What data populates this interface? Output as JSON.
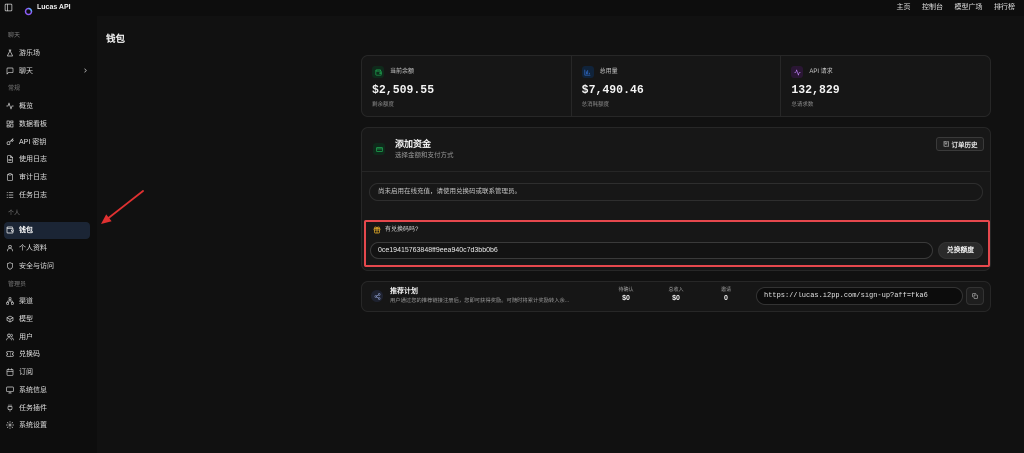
{
  "app": {
    "title": "Lucas API",
    "logo_icon": "logo-ring-icon",
    "toggle_icon": "sidebar-toggle-icon"
  },
  "topnav": {
    "items": [
      {
        "label": "主页"
      },
      {
        "label": "控制台"
      },
      {
        "label": "模型广场"
      },
      {
        "label": "排行榜"
      }
    ]
  },
  "sidebar": {
    "sections": [
      {
        "label": "聊天",
        "items": [
          {
            "label": "游乐场",
            "icon": "flask-icon"
          },
          {
            "label": "聊天",
            "icon": "message-icon",
            "has_submenu": true
          }
        ]
      },
      {
        "label": "常规",
        "items": [
          {
            "label": "概览",
            "icon": "activity-icon"
          },
          {
            "label": "数据看板",
            "icon": "dashboard-icon"
          },
          {
            "label": "API 密钥",
            "icon": "key-icon"
          },
          {
            "label": "使用日志",
            "icon": "file-text-icon"
          },
          {
            "label": "审计日志",
            "icon": "clipboard-icon"
          },
          {
            "label": "任务日志",
            "icon": "list-icon"
          }
        ]
      },
      {
        "label": "个人",
        "items": [
          {
            "label": "钱包",
            "icon": "wallet-icon",
            "active": true
          },
          {
            "label": "个人资料",
            "icon": "user-icon"
          },
          {
            "label": "安全与访问",
            "icon": "shield-icon"
          }
        ]
      },
      {
        "label": "管理员",
        "items": [
          {
            "label": "渠道",
            "icon": "network-icon"
          },
          {
            "label": "模型",
            "icon": "box-icon"
          },
          {
            "label": "用户",
            "icon": "users-icon"
          },
          {
            "label": "兑换码",
            "icon": "ticket-icon"
          },
          {
            "label": "订阅",
            "icon": "calendar-icon"
          },
          {
            "label": "系统信息",
            "icon": "monitor-icon"
          },
          {
            "label": "任务插件",
            "icon": "plug-icon"
          },
          {
            "label": "系统设置",
            "icon": "gear-icon"
          }
        ]
      }
    ]
  },
  "page": {
    "title": "钱包"
  },
  "stats": [
    {
      "label": "当前余额",
      "value": "$2,509.55",
      "caption": "剩余额度",
      "icon": "wallet-icon",
      "color": "#22c55e"
    },
    {
      "label": "总用量",
      "value": "$7,490.46",
      "caption": "总消耗额度",
      "icon": "bar-chart-icon",
      "color": "#3b82f6"
    },
    {
      "label": "API 请求",
      "value": "132,829",
      "caption": "总请求数",
      "icon": "activity-icon",
      "color": "#c084fc"
    }
  ],
  "add_funds": {
    "title": "添加资金",
    "subtitle": "选择金额和支付方式",
    "icon": "credit-card-icon",
    "history_button": "订单历史",
    "history_icon": "receipt-icon",
    "notice": "尚未启用在线充值，请使用兑换码或联系管理员。",
    "redeem_label": "有兑换码吗?",
    "redeem_icon": "gift-icon",
    "redeem_code": "0ce19415763848ff9eea940c7d3bb0b6",
    "redeem_button": "兑换额度"
  },
  "referral": {
    "title": "推荐计划",
    "icon": "share-icon",
    "description": "用户通过您的推荐链接注册后，您即可获得奖励。可随时将累计奖励转入余...",
    "stats": [
      {
        "label": "待确认",
        "value": "$0"
      },
      {
        "label": "总收入",
        "value": "$0"
      },
      {
        "label": "邀请",
        "value": "0"
      }
    ],
    "link": "https://lucas.i2pp.com/sign-up?aff=fka6",
    "copy_icon": "copy-icon"
  },
  "colors": {
    "background": "#111111",
    "sidebar": "#0d0d0d",
    "card": "#161616",
    "active_nav": "#1b2535",
    "highlight_border": "#e5484d",
    "annotation_arrow": "#e03131"
  }
}
